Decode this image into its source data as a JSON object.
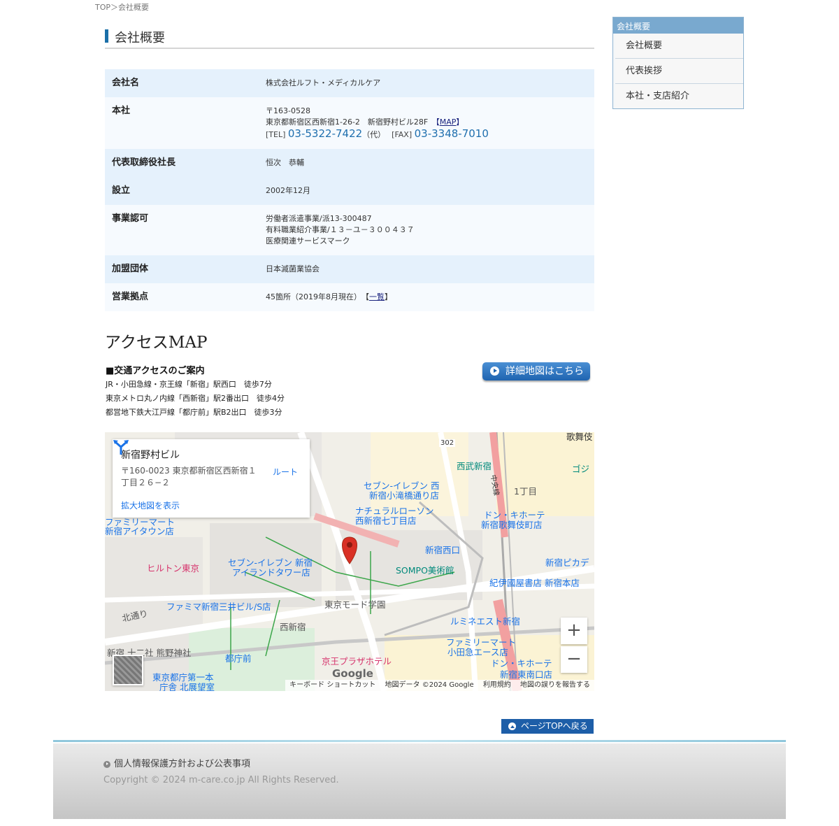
{
  "breadcrumb": "TOP＞会社概要",
  "page_title": "会社概要",
  "company": {
    "rows": [
      {
        "label": "会社名",
        "lines": [
          "株式会社ルフト・メディカルケア"
        ]
      },
      {
        "label": "本社",
        "postal": "〒163-0528",
        "address": "東京都新宿区西新宿1-26-2　新宿野村ビル28F　",
        "map_open": "【",
        "map_link": "MAP",
        "map_close": "】",
        "tel_label": "[TEL]",
        "tel": "03-5322-7422",
        "tel_suffix": "（代）",
        "fax_label": "[FAX]",
        "fax": "03-3348-7010"
      },
      {
        "label": "代表取締役社長",
        "lines": [
          "恒次　恭輔"
        ]
      },
      {
        "label": "設立",
        "lines": [
          "2002年12月"
        ]
      },
      {
        "label": "事業認可",
        "lines": [
          "労働者派遣事業/派13-300487",
          "有料職業紹介事業/１３－ユ－３００４３７",
          "医療関連サービスマーク"
        ]
      },
      {
        "label": "加盟団体",
        "lines": [
          "日本滅菌業協会"
        ]
      },
      {
        "label": "営業拠点",
        "text": "45箇所（2019年8月現在）　【",
        "link": "一覧",
        "close": "】"
      }
    ]
  },
  "sidebar": {
    "heading": "会社概要",
    "items": [
      "会社概要",
      "代表挨拶",
      "本社・支店紹介"
    ]
  },
  "access": {
    "title": "アクセスMAP",
    "subtitle": "■交通アクセスのご案内",
    "lines": [
      "JR・小田急線・京王線「新宿」駅西口　徒歩7分",
      "東京メトロ丸ノ内線「西新宿」駅2番出口　徒歩4分",
      "都営地下鉄大江戸線「都庁前」駅B2出口　徒歩3分"
    ],
    "detail_button": "詳細地図はこちら"
  },
  "map": {
    "card_title": "新宿野村ビル",
    "card_address": "〒160-0023 東京都新宿区西新宿１丁目２６−２",
    "card_link": "拡大地図を表示",
    "route_label": "ルート",
    "zoom_in": "+",
    "zoom_out": "−",
    "google_logo": "Google",
    "footer": [
      "キーボード ショートカット",
      "地図データ ©2024 Google",
      "利用規約",
      "地図の誤りを報告する"
    ],
    "labels": {
      "seibu_shinjuku": "西武新宿",
      "seven_otakibashi_1": "セブン-イレブン 西",
      "seven_otakibashi_2": "新宿小滝橋通り店",
      "natural_lawson_1": "ナチュラルローソン",
      "natural_lawson_2": "西新宿七丁目店",
      "donki_kabuki_1": "ドン・キホーテ",
      "donki_kabuki_2": "新宿歌舞伎町店",
      "familymart_island_1": "ファミリーマート",
      "familymart_island_2": "新宿アイタウン店",
      "hilton": "ヒルトン東京",
      "seven_island_1": "セブン-イレブン 新宿",
      "seven_island_2": "アイランドタワー店",
      "shinjuku_nishiguchi": "新宿西口",
      "sompo": "SOMPO美術館",
      "kinokuniya": "紀伊國屋書店 新宿本店",
      "shinjuku_picca": "新宿ピカデ",
      "famima_mitsui": "ファミマ新宿三井ビル/S店",
      "mode_gakuen": "東京モード学園",
      "nishi_shinjuku": "西新宿",
      "lumine_est": "ルミネエスト新宿",
      "kitadori": "北通り",
      "jyunisha": "新宿 十二社 熊野神社",
      "tochomae": "都庁前",
      "keio_plaza": "京王プラザホテル",
      "familymart_odakyu_1": "ファミリーマート",
      "familymart_odakyu_2": "小田急エース店",
      "donki_south_1": "ドン・キホーテ",
      "donki_south_2": "新宿東南口店",
      "tocho_1": "東京都庁第一本",
      "tocho_2": "庁舎 北展望室",
      "kabukicho": "歌舞伎",
      "chuo_line": "中央線",
      "itchome": "1丁目",
      "route302": "302",
      "gojira": "ゴジ"
    }
  },
  "pagetop": "ページTOPへ戻る",
  "footer": {
    "privacy_link": "個人情報保護方針および公表事項",
    "copyright": "Copyright © 2024 m-care.co.jp All Rights Reserved."
  },
  "colors": {
    "accent": "#1b6fa8",
    "row_dark": "#e5f1fc",
    "row_light": "#f6fafe",
    "sidebar_head": "#79a9cf",
    "map_pin": "#d93025"
  }
}
